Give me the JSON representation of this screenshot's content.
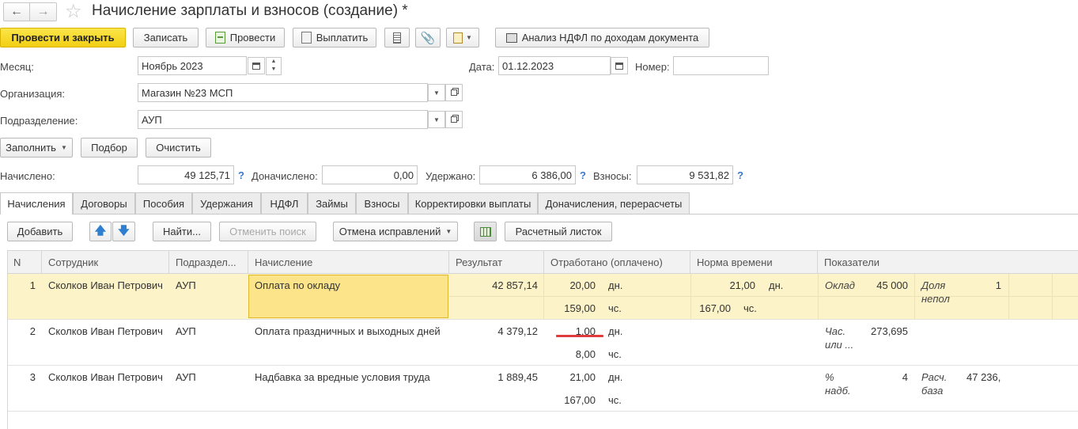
{
  "window": {
    "title": "Начисление зарплаты и взносов (создание) *"
  },
  "toolbar": {
    "post_close": "Провести и закрыть",
    "save": "Записать",
    "post": "Провести",
    "pay": "Выплатить",
    "ndfl_analysis": "Анализ НДФЛ по доходам документа"
  },
  "form": {
    "month_label": "Месяц:",
    "month_value": "Ноябрь 2023",
    "date_label": "Дата:",
    "date_value": "01.12.2023",
    "number_label": "Номер:",
    "number_value": "",
    "org_label": "Организация:",
    "org_value": "Магазин №23 МСП",
    "dept_label": "Подразделение:",
    "dept_value": "АУП"
  },
  "actions": {
    "fill": "Заполнить",
    "select": "Подбор",
    "clear": "Очистить"
  },
  "totals": {
    "accrued_label": "Начислено:",
    "accrued": "49 125,71",
    "extra_label": "Доначислено:",
    "extra": "0,00",
    "withheld_label": "Удержано:",
    "withheld": "6 386,00",
    "contrib_label": "Взносы:",
    "contrib": "9 531,82",
    "help": "?"
  },
  "tabs": [
    "Начисления",
    "Договоры",
    "Пособия",
    "Удержания",
    "НДФЛ",
    "Займы",
    "Взносы",
    "Корректировки выплаты",
    "Доначисления, перерасчеты"
  ],
  "table_toolbar": {
    "add": "Добавить",
    "find": "Найти...",
    "cancel_search": "Отменить поиск",
    "cancel_fix": "Отмена исправлений",
    "payslip": "Расчетный листок"
  },
  "columns": {
    "n": "N",
    "employee": "Сотрудник",
    "dept": "Подраздел...",
    "accrual": "Начисление",
    "result": "Результат",
    "worked": "Отработано (оплачено)",
    "norm": "Норма времени",
    "indicators": "Показатели"
  },
  "rows": [
    {
      "n": "1",
      "employee": "Сколков Иван Петрович",
      "dept": "АУП",
      "accrual": "Оплата по окладу",
      "result": "42 857,14",
      "worked_days": "20,00",
      "days_unit": "дн.",
      "worked_hours": "159,00",
      "hours_unit": "чс.",
      "norm_days": "21,00",
      "norm_days_unit": "дн.",
      "norm_hours": "167,00",
      "norm_hours_unit": "чс.",
      "ind1_name": "Оклад",
      "ind1_value": "45 000",
      "ind2_name_1": "Доля",
      "ind2_name_2": "непол",
      "ind2_value": "1"
    },
    {
      "n": "2",
      "employee": "Сколков Иван Петрович",
      "dept": "АУП",
      "accrual": "Оплата праздничных и выходных дней",
      "result": "4 379,12",
      "worked_days": "1,00",
      "days_unit": "дн.",
      "worked_hours": "8,00",
      "hours_unit": "чс.",
      "ind1_name_1": "Час.",
      "ind1_name_2": "или ...",
      "ind1_value": "273,695"
    },
    {
      "n": "3",
      "employee": "Сколков Иван Петрович",
      "dept": "АУП",
      "accrual": "Надбавка за вредные условия труда",
      "result": "1 889,45",
      "worked_days": "21,00",
      "days_unit": "дн.",
      "worked_hours": "167,00",
      "hours_unit": "чс.",
      "ind1_name_1": "%",
      "ind1_name_2": "надб.",
      "ind1_value": "4",
      "ind2_name_1": "Расч.",
      "ind2_name_2": "база",
      "ind2_value": "47 236,"
    }
  ],
  "colors": {
    "primary_button": "#f2cf13",
    "selected_row": "#fdf3c8",
    "selected_cell": "#fce48a",
    "help": "#3a79c8",
    "annotation": "#e03c3c"
  }
}
